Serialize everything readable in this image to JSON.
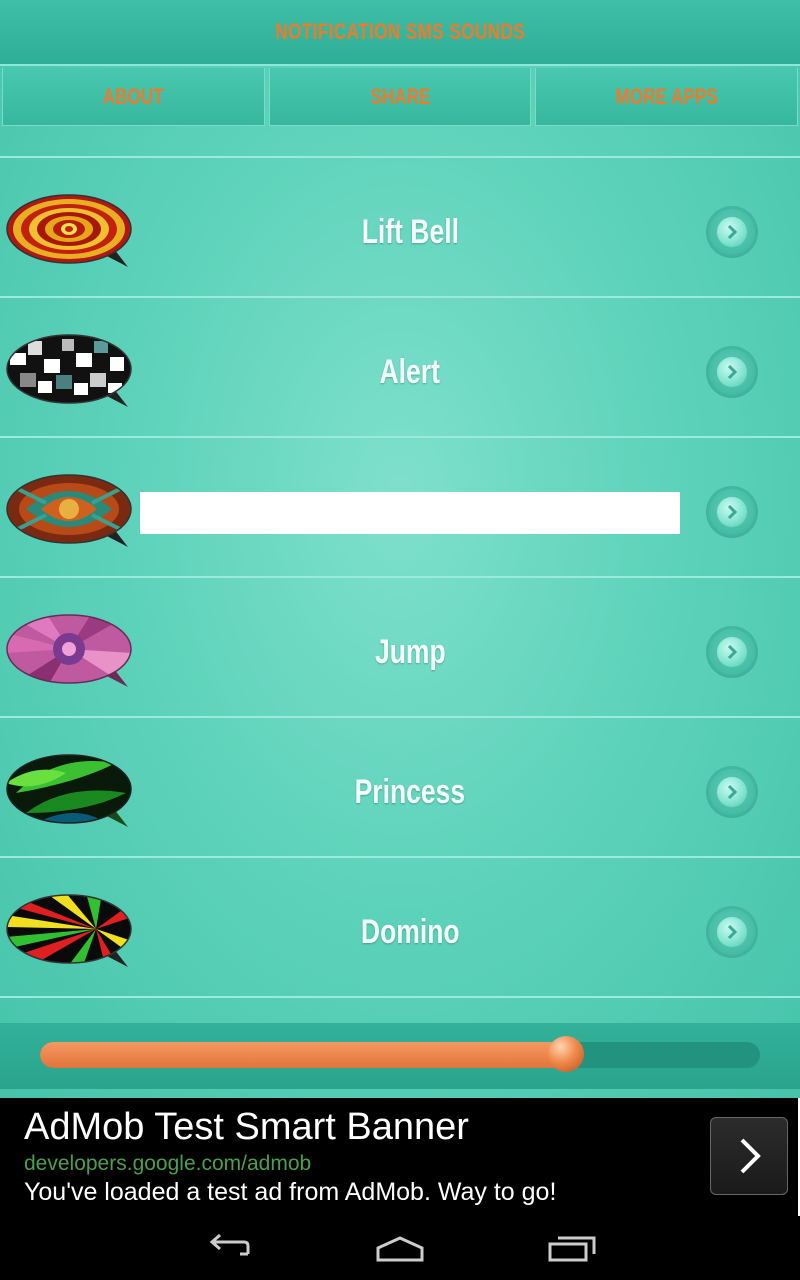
{
  "app": {
    "title": "NOTIFICATION SMS SOUNDS"
  },
  "tabs": [
    {
      "label": "ABOUT"
    },
    {
      "label": "SHARE"
    },
    {
      "label": "MORE APPS"
    }
  ],
  "sounds": [
    {
      "name": "Lift Bell",
      "icon": "bubble-rings-icon"
    },
    {
      "name": "Alert",
      "icon": "bubble-mosaic-icon"
    },
    {
      "name": "",
      "icon": "bubble-ornament-icon"
    },
    {
      "name": "Jump",
      "icon": "bubble-kaleidoscope-icon"
    },
    {
      "name": "Princess",
      "icon": "bubble-leaf-icon"
    },
    {
      "name": "Domino",
      "icon": "bubble-rays-icon"
    }
  ],
  "player": {
    "progress": 0.73
  },
  "ad": {
    "title": "AdMob Test Smart Banner",
    "url": "developers.google.com/admob",
    "text": "You've loaded a test ad from AdMob. Way to go!"
  },
  "colors": {
    "accent": "#ee7a2c",
    "background": "#5fd3bb"
  }
}
